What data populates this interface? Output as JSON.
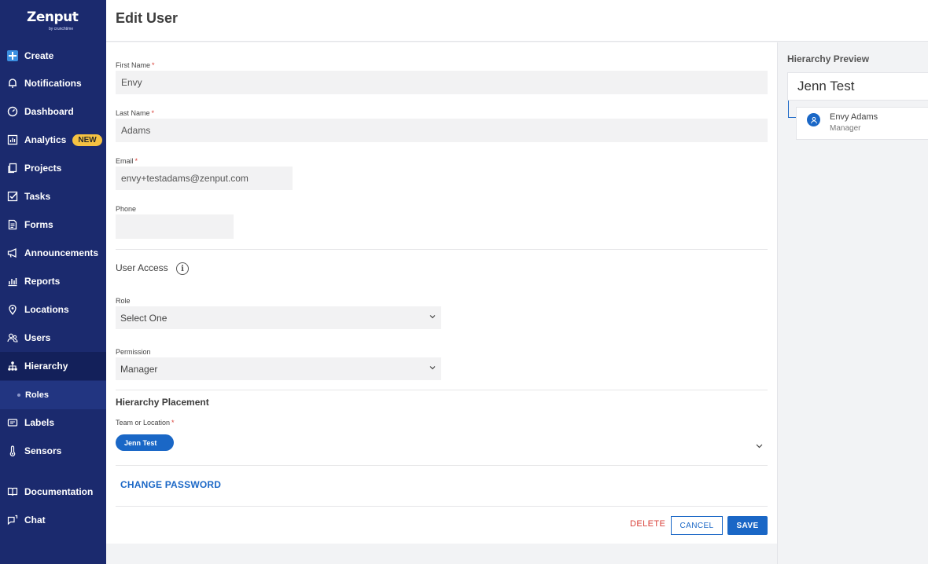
{
  "brand": {
    "logo_text": "Zenput",
    "logo_sub": "by crunchtime"
  },
  "sidebar": {
    "items": [
      {
        "label": "Create",
        "icon": "plus-icon"
      },
      {
        "label": "Notifications",
        "icon": "bell-icon"
      },
      {
        "label": "Dashboard",
        "icon": "gauge-icon"
      },
      {
        "label": "Analytics",
        "icon": "bar-chart-icon",
        "badge": "NEW"
      },
      {
        "label": "Projects",
        "icon": "copy-icon"
      },
      {
        "label": "Tasks",
        "icon": "checkbox-icon"
      },
      {
        "label": "Forms",
        "icon": "document-icon"
      },
      {
        "label": "Announcements",
        "icon": "megaphone-icon"
      },
      {
        "label": "Reports",
        "icon": "report-icon"
      },
      {
        "label": "Locations",
        "icon": "map-pin-icon"
      },
      {
        "label": "Users",
        "icon": "users-icon"
      },
      {
        "label": "Hierarchy",
        "icon": "hierarchy-icon",
        "active": true
      },
      {
        "label": "Roles",
        "sub": true
      },
      {
        "label": "Labels",
        "icon": "label-icon"
      },
      {
        "label": "Sensors",
        "icon": "thermometer-icon"
      },
      {
        "label": "Documentation",
        "icon": "book-icon"
      },
      {
        "label": "Chat",
        "icon": "chat-icon"
      }
    ]
  },
  "header": {
    "title": "Edit User"
  },
  "form": {
    "first_name": {
      "label": "First Name",
      "value": "Envy"
    },
    "last_name": {
      "label": "Last Name",
      "value": "Adams"
    },
    "email": {
      "label": "Email",
      "value": "envy+testadams@zenput.com"
    },
    "phone": {
      "label": "Phone",
      "value": ""
    },
    "required_mark": "*",
    "user_access": {
      "title": "User Access",
      "info_glyph": "i"
    },
    "role": {
      "label": "Role",
      "value": "Select One"
    },
    "permission": {
      "label": "Permission",
      "value": "Manager"
    },
    "hierarchy_placement": {
      "title": "Hierarchy Placement"
    },
    "team_or_location": {
      "label": "Team or Location",
      "chip": "Jenn Test"
    },
    "change_password": "CHANGE PASSWORD",
    "actions": {
      "delete": "DELETE",
      "cancel": "CANCEL",
      "save": "SAVE"
    }
  },
  "preview": {
    "title": "Hierarchy Preview",
    "root": "Jenn Test",
    "node": {
      "name": "Envy Adams",
      "role": "Manager"
    }
  },
  "colors": {
    "sidebar": "#1b2a6e",
    "accent": "#1a67c6",
    "danger": "#d9433b",
    "badge": "#f5c242"
  }
}
